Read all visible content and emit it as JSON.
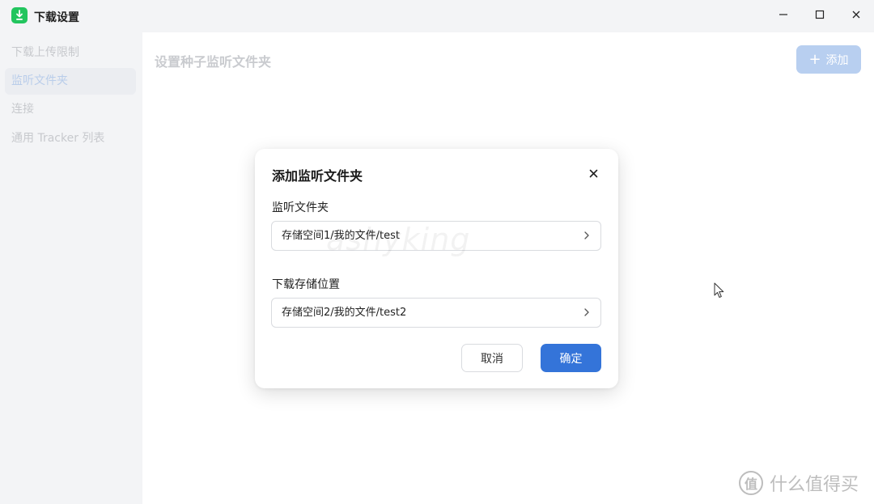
{
  "window": {
    "title": "下载设置",
    "controls": [
      "minimize-icon",
      "maximize-icon",
      "close-icon"
    ]
  },
  "sidebar": {
    "items": [
      {
        "label": "下载上传限制",
        "active": false
      },
      {
        "label": "监听文件夹",
        "active": true
      },
      {
        "label": "连接",
        "active": false
      },
      {
        "label": "通用 Tracker 列表",
        "active": false
      }
    ]
  },
  "main": {
    "title": "设置种子监听文件夹",
    "add_button": {
      "icon": "plus-icon",
      "label": "添加"
    }
  },
  "dialog": {
    "title": "添加监听文件夹",
    "watch_folder": {
      "label": "监听文件夹",
      "value": "存储空间1/我的文件/test"
    },
    "download_location": {
      "label": "下载存储位置",
      "value": "存储空间2/我的文件/test2"
    },
    "watermark": "ashyking",
    "cancel_label": "取消",
    "confirm_label": "确定"
  },
  "brand": {
    "logo": "值",
    "text": "什么值得买"
  },
  "colors": {
    "accent": "#3474d9",
    "accent_disabled": "#b8cff0",
    "app_icon": "#22c55e",
    "sidebar_bg": "#f3f4f6"
  }
}
